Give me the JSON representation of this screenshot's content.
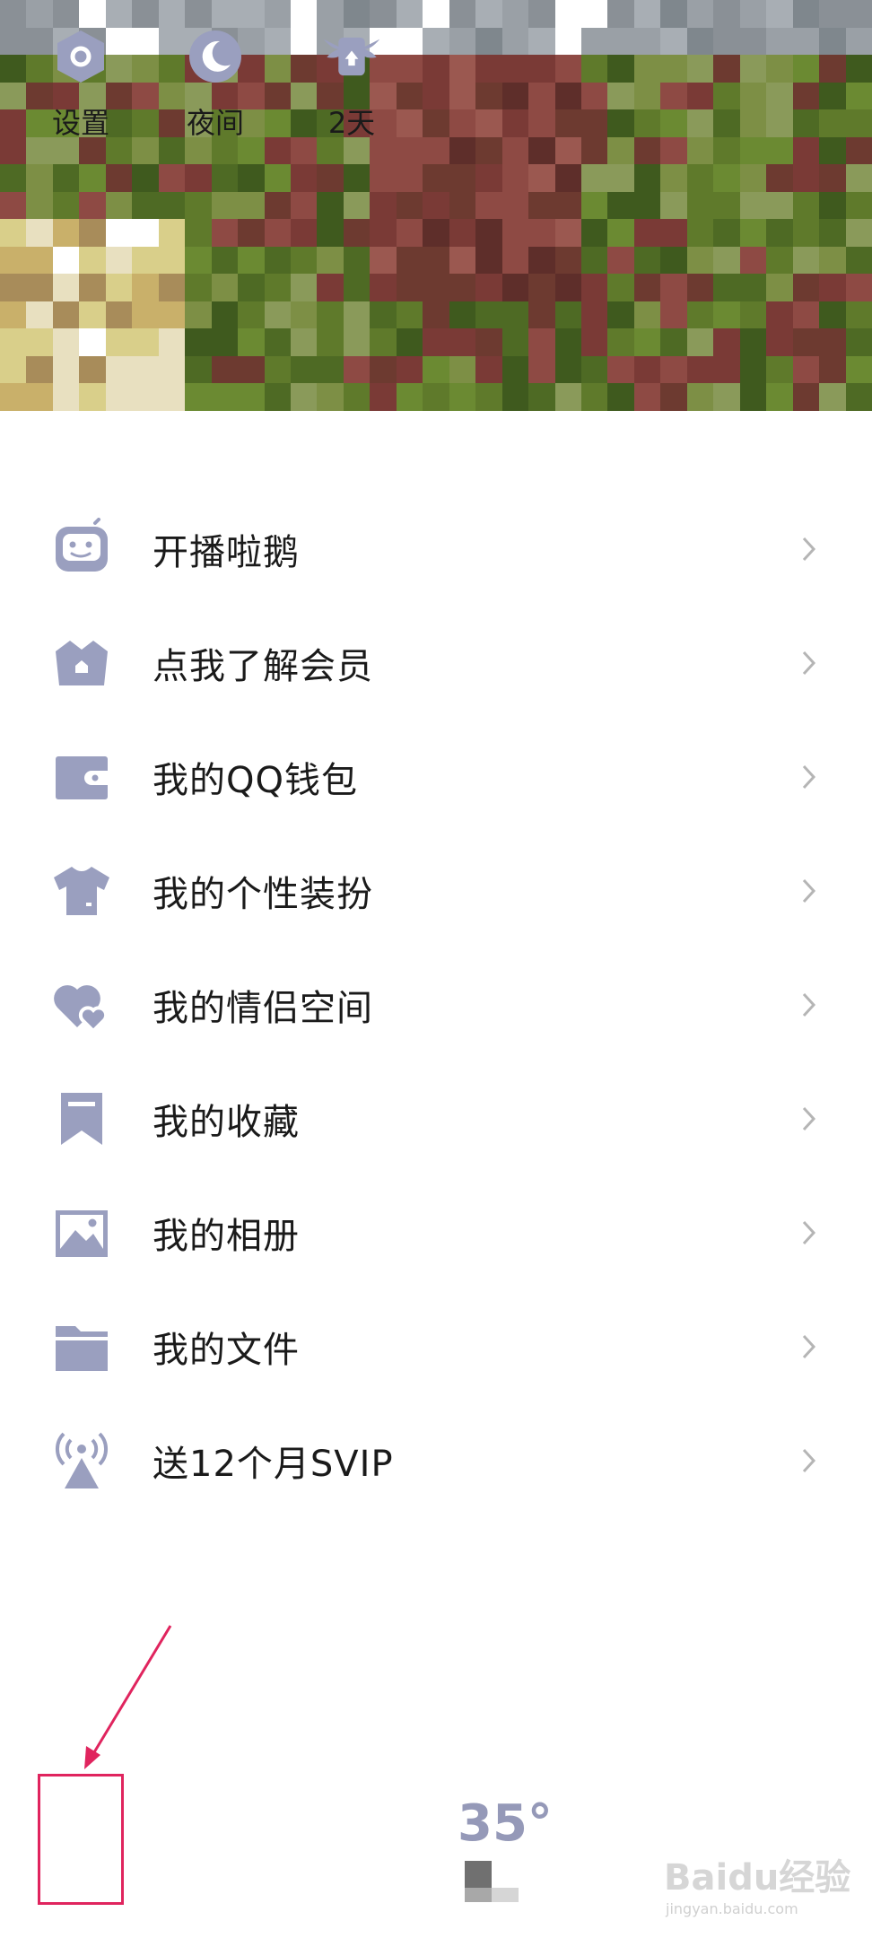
{
  "menu": {
    "items": [
      {
        "icon": "robot-tv-icon",
        "label": "开播啦鹅"
      },
      {
        "icon": "crown-icon",
        "label": "点我了解会员"
      },
      {
        "icon": "wallet-icon",
        "label": "我的QQ钱包"
      },
      {
        "icon": "tshirt-icon",
        "label": "我的个性装扮"
      },
      {
        "icon": "hearts-icon",
        "label": "我的情侣空间"
      },
      {
        "icon": "bookmark-icon",
        "label": "我的收藏"
      },
      {
        "icon": "image-icon",
        "label": "我的相册"
      },
      {
        "icon": "folder-icon",
        "label": "我的文件"
      },
      {
        "icon": "broadcast-icon",
        "label": "送12个月SVIP"
      }
    ]
  },
  "bottom": {
    "settings_label": "设置",
    "night_label": "夜间",
    "days_label": "2天",
    "temperature": "35°"
  },
  "watermark": {
    "text": "Baidu经验",
    "url": "jingyan.baidu.com"
  },
  "colors": {
    "icon": "#9a9fbf",
    "chevron": "#b5b5b5",
    "annotation": "#e0245e"
  }
}
